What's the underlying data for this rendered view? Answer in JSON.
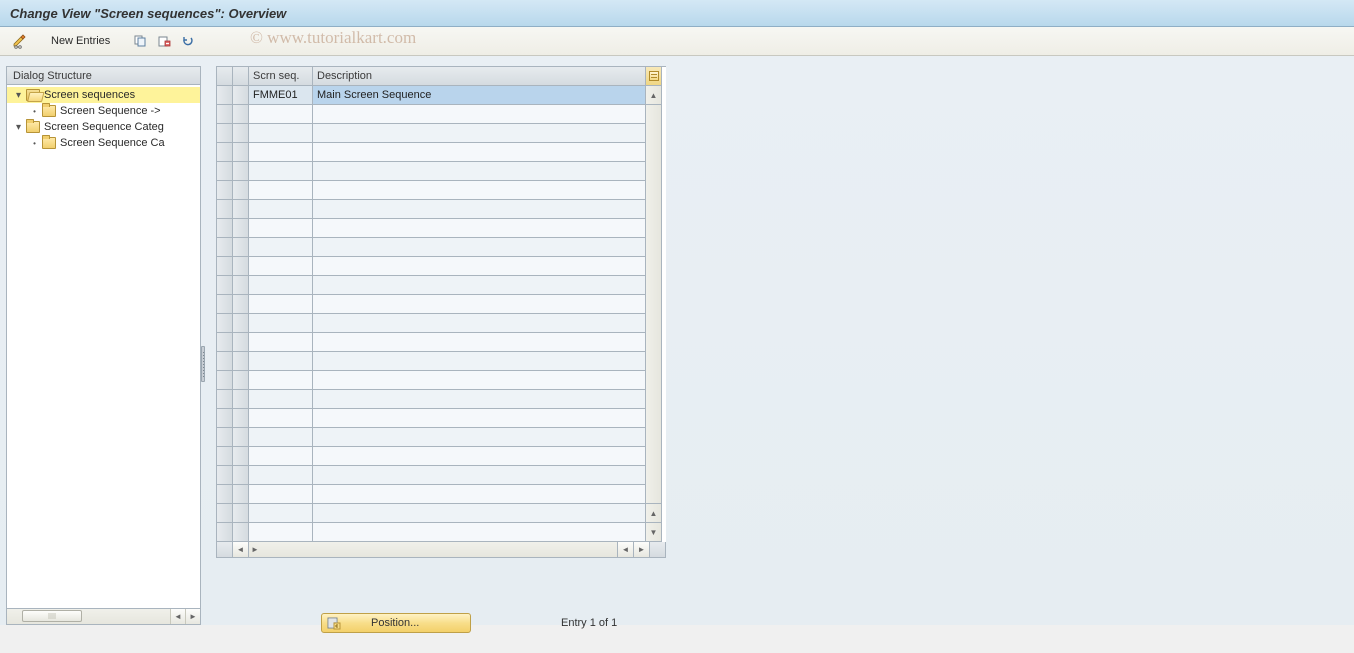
{
  "title": "Change View \"Screen sequences\": Overview",
  "toolbar": {
    "new_entries_label": "New Entries"
  },
  "watermark": "© www.tutorialkart.com",
  "sidebar": {
    "header": "Dialog Structure",
    "nodes": [
      {
        "label": "Screen sequences",
        "level": 0,
        "expandable": true,
        "open": true,
        "selected": true
      },
      {
        "label": "Screen Sequence ->",
        "level": 1,
        "expandable": false,
        "open": false,
        "selected": false
      },
      {
        "label": "Screen Sequence Categ",
        "level": 0,
        "expandable": true,
        "open": true,
        "selected": false
      },
      {
        "label": "Screen Sequence Ca",
        "level": 1,
        "expandable": false,
        "open": false,
        "selected": false
      }
    ]
  },
  "grid": {
    "columns": [
      "Scrn seq.",
      "Description"
    ],
    "rows": [
      {
        "code": "FMME01",
        "description": "Main Screen Sequence"
      }
    ],
    "empty_rows": 23
  },
  "position_button_label": "Position...",
  "entry_text": "Entry 1 of 1"
}
